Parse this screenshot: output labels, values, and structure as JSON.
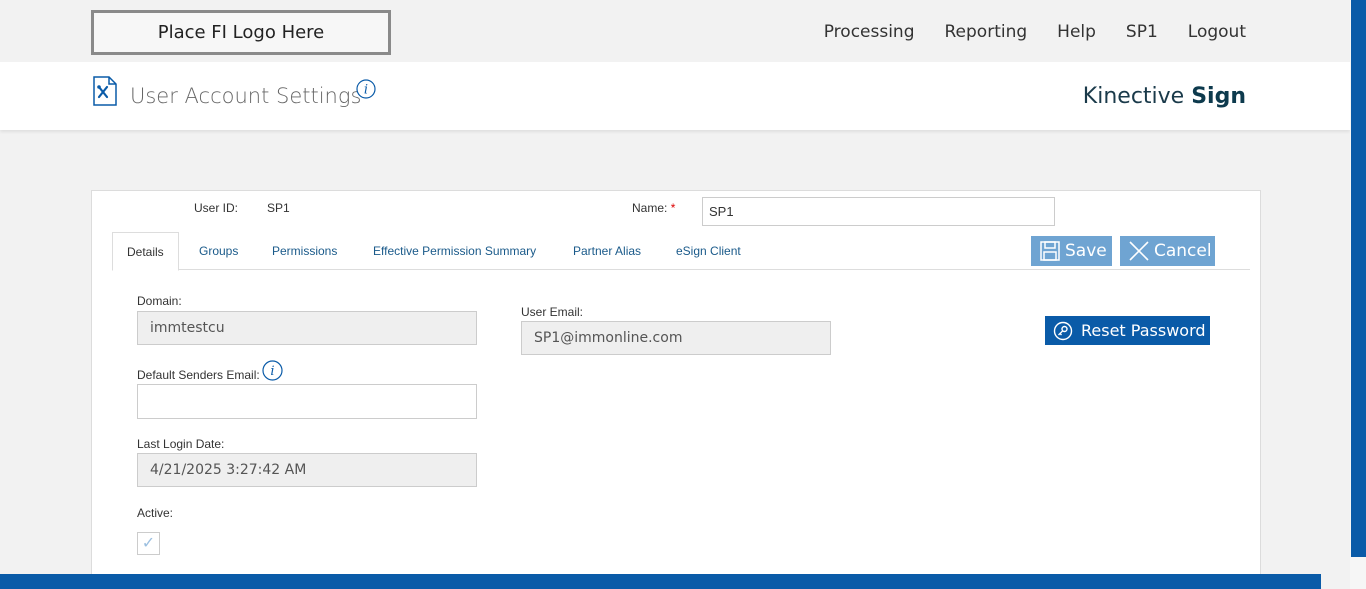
{
  "top": {
    "logo_placeholder": "Place FI Logo Here",
    "nav": [
      "Processing",
      "Reporting",
      "Help",
      "SP1",
      "Logout"
    ]
  },
  "header": {
    "title": "User Account Settings",
    "brand_light": "Kinective",
    "brand_bold": "Sign"
  },
  "form": {
    "user_id_label": "User ID:",
    "user_id_value": "SP1",
    "name_label": "Name:",
    "name_required": "*",
    "name_value": "SP1",
    "tabs": [
      "Details",
      "Groups",
      "Permissions",
      "Effective Permission Summary",
      "Partner Alias",
      "eSign Client"
    ],
    "save_label": "Save",
    "cancel_label": "Cancel",
    "reset_password_label": "Reset Password",
    "domain_label": "Domain:",
    "domain_value": "immtestcu",
    "user_email_label": "User Email:",
    "user_email_value": "SP1@immonline.com",
    "default_senders_email_label": "Default Senders Email:",
    "default_senders_email_value": "",
    "last_login_label": "Last Login Date:",
    "last_login_value": "4/21/2025 3:27:42 AM",
    "active_label": "Active:",
    "active_checked": true
  },
  "colors": {
    "primary": "#0a5ba8",
    "button_light": "#6fa4d2",
    "brand_text": "#0d3a4d"
  }
}
